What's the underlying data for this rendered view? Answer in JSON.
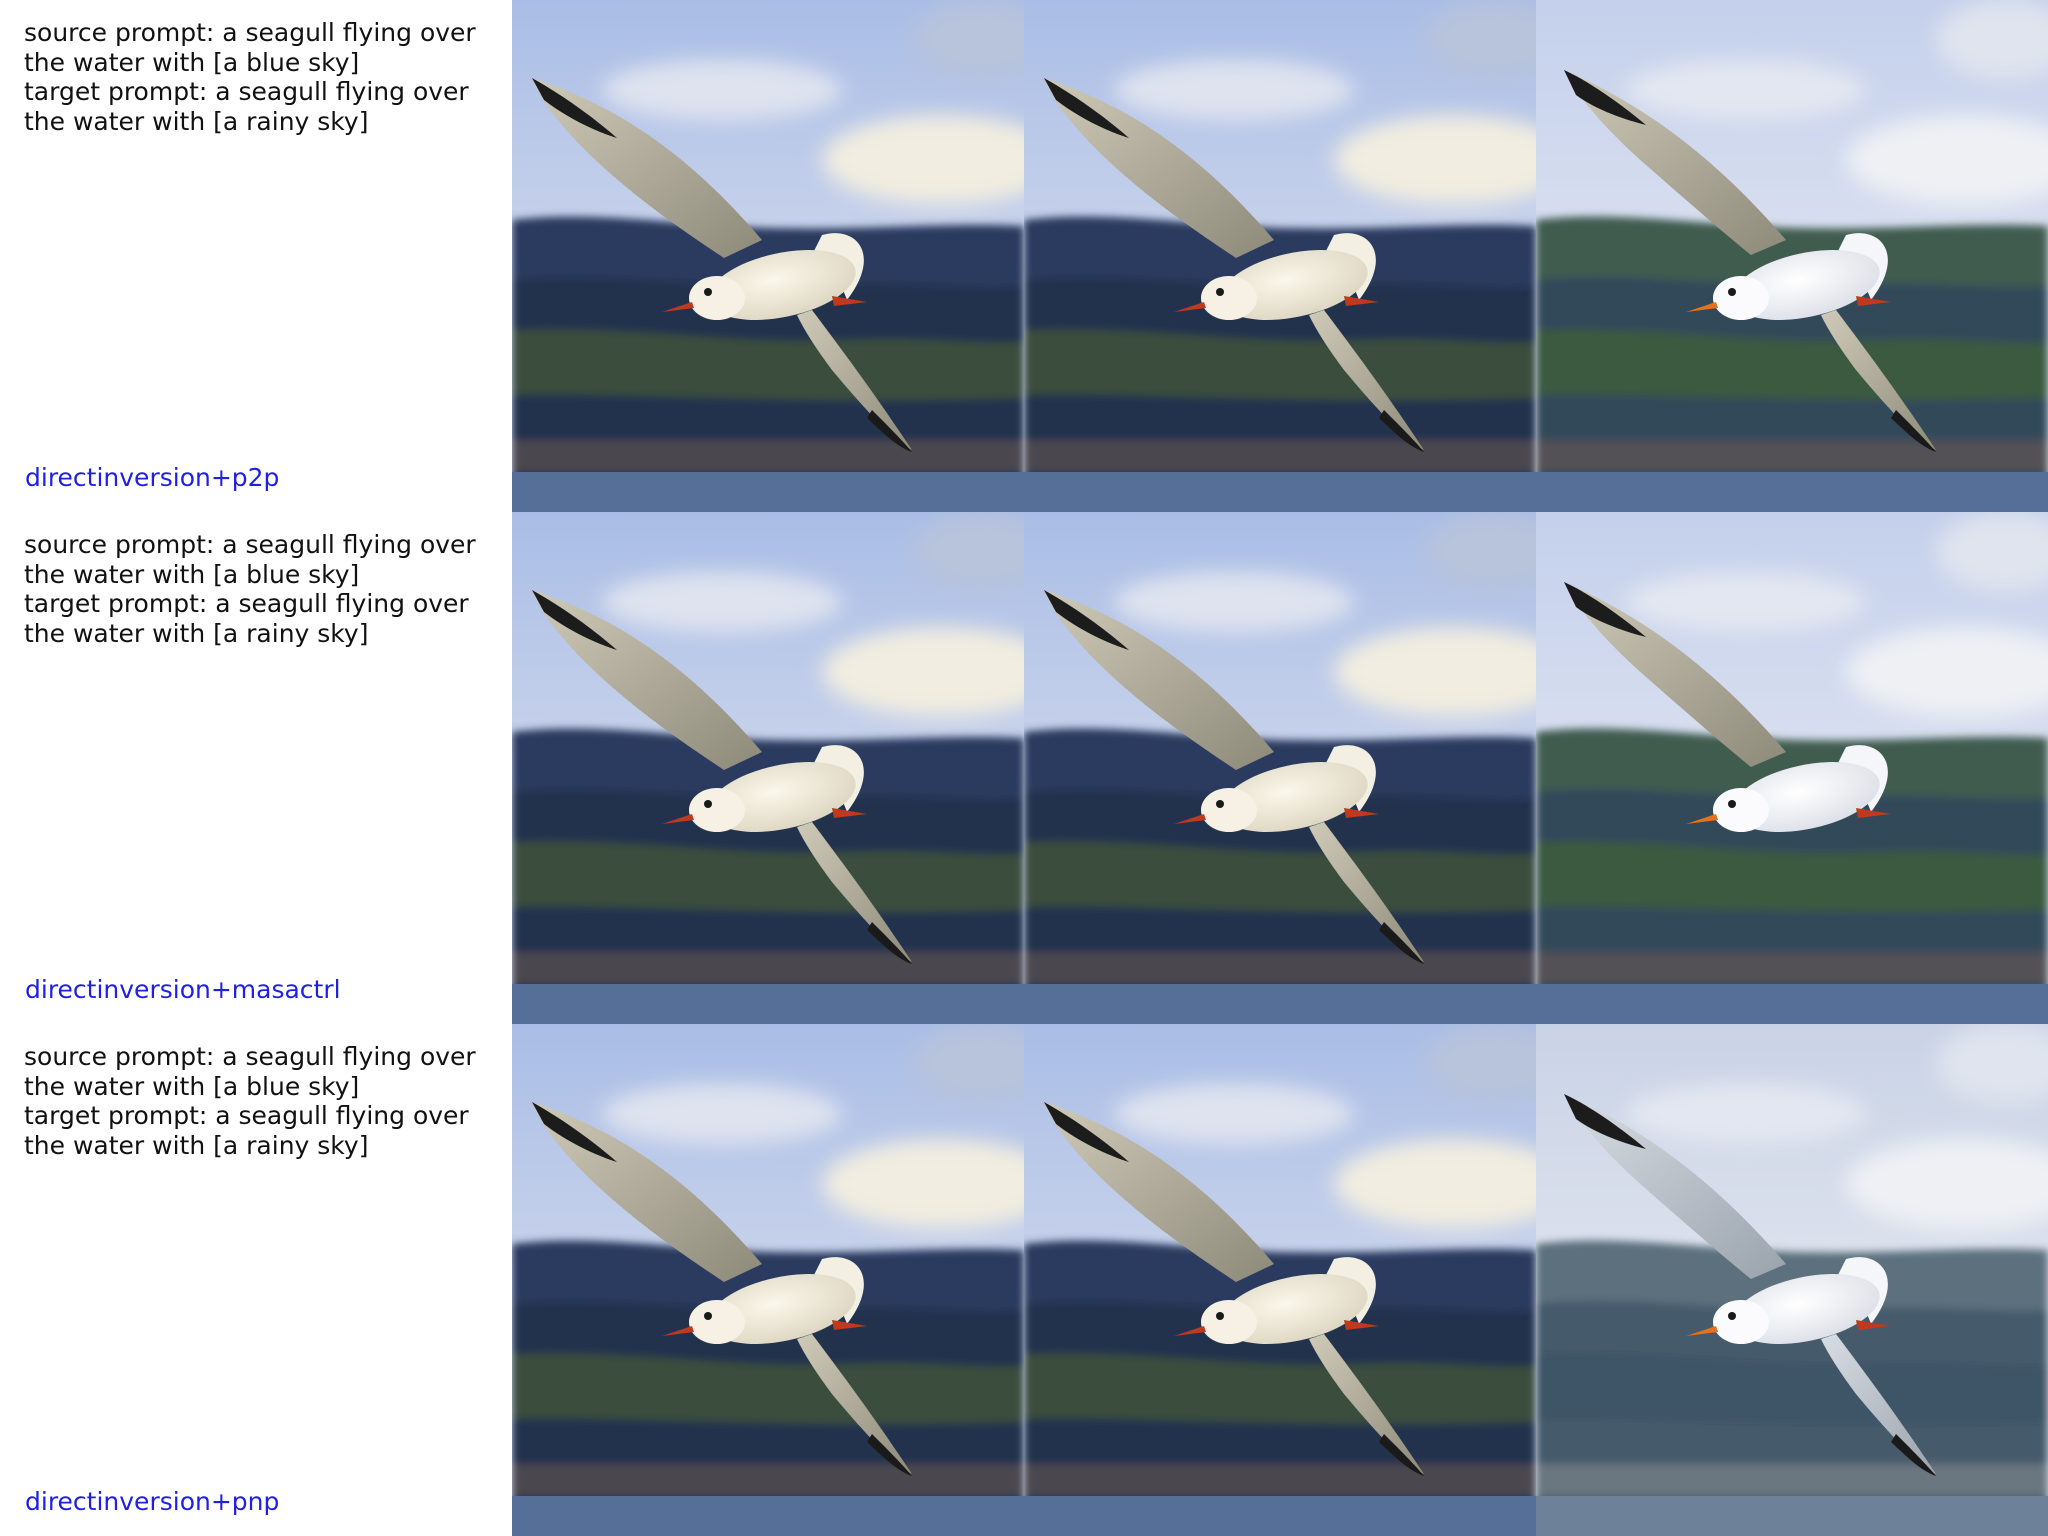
{
  "rows": [
    {
      "source_label": "source prompt: a seagull flying over",
      "source_cont": "the water with [a blue sky]",
      "target_label": "target prompt: a seagull flying over",
      "target_cont": "the water with [a rainy sky]",
      "method": "directinversion+p2p",
      "images": [
        {
          "description": "seagull-source",
          "sky": "blue",
          "variant": "source"
        },
        {
          "description": "seagull-reconstruction",
          "sky": "blue",
          "variant": "recon"
        },
        {
          "description": "seagull-edited",
          "sky": "rainy",
          "variant": "edit"
        }
      ]
    },
    {
      "source_label": "source prompt: a seagull flying over",
      "source_cont": "the water with [a blue sky]",
      "target_label": "target prompt: a seagull flying over",
      "target_cont": "the water with [a rainy sky]",
      "method": "directinversion+masactrl",
      "images": [
        {
          "description": "seagull-source",
          "sky": "blue",
          "variant": "source"
        },
        {
          "description": "seagull-reconstruction",
          "sky": "blue",
          "variant": "recon"
        },
        {
          "description": "seagull-edited",
          "sky": "rainy",
          "variant": "edit-partial"
        }
      ]
    },
    {
      "source_label": "source prompt: a seagull flying over",
      "source_cont": "the water with [a blue sky]",
      "target_label": "target prompt: a seagull flying over",
      "target_cont": "the water with [a rainy sky]",
      "method": "directinversion+pnp",
      "images": [
        {
          "description": "seagull-source",
          "sky": "blue",
          "variant": "source"
        },
        {
          "description": "seagull-reconstruction",
          "sky": "blue",
          "variant": "recon"
        },
        {
          "description": "seagull-edited",
          "sky": "rainy",
          "variant": "edit-grey"
        }
      ]
    }
  ],
  "colors": {
    "label_blue": "#1f1fe6",
    "text": "#111111",
    "sky_top": "#b6c4e6",
    "sky_mid": "#d4dbeb",
    "hills_dark": "#2b3a5c",
    "hills_green": "#3b5a3a",
    "water": "#566e96"
  }
}
